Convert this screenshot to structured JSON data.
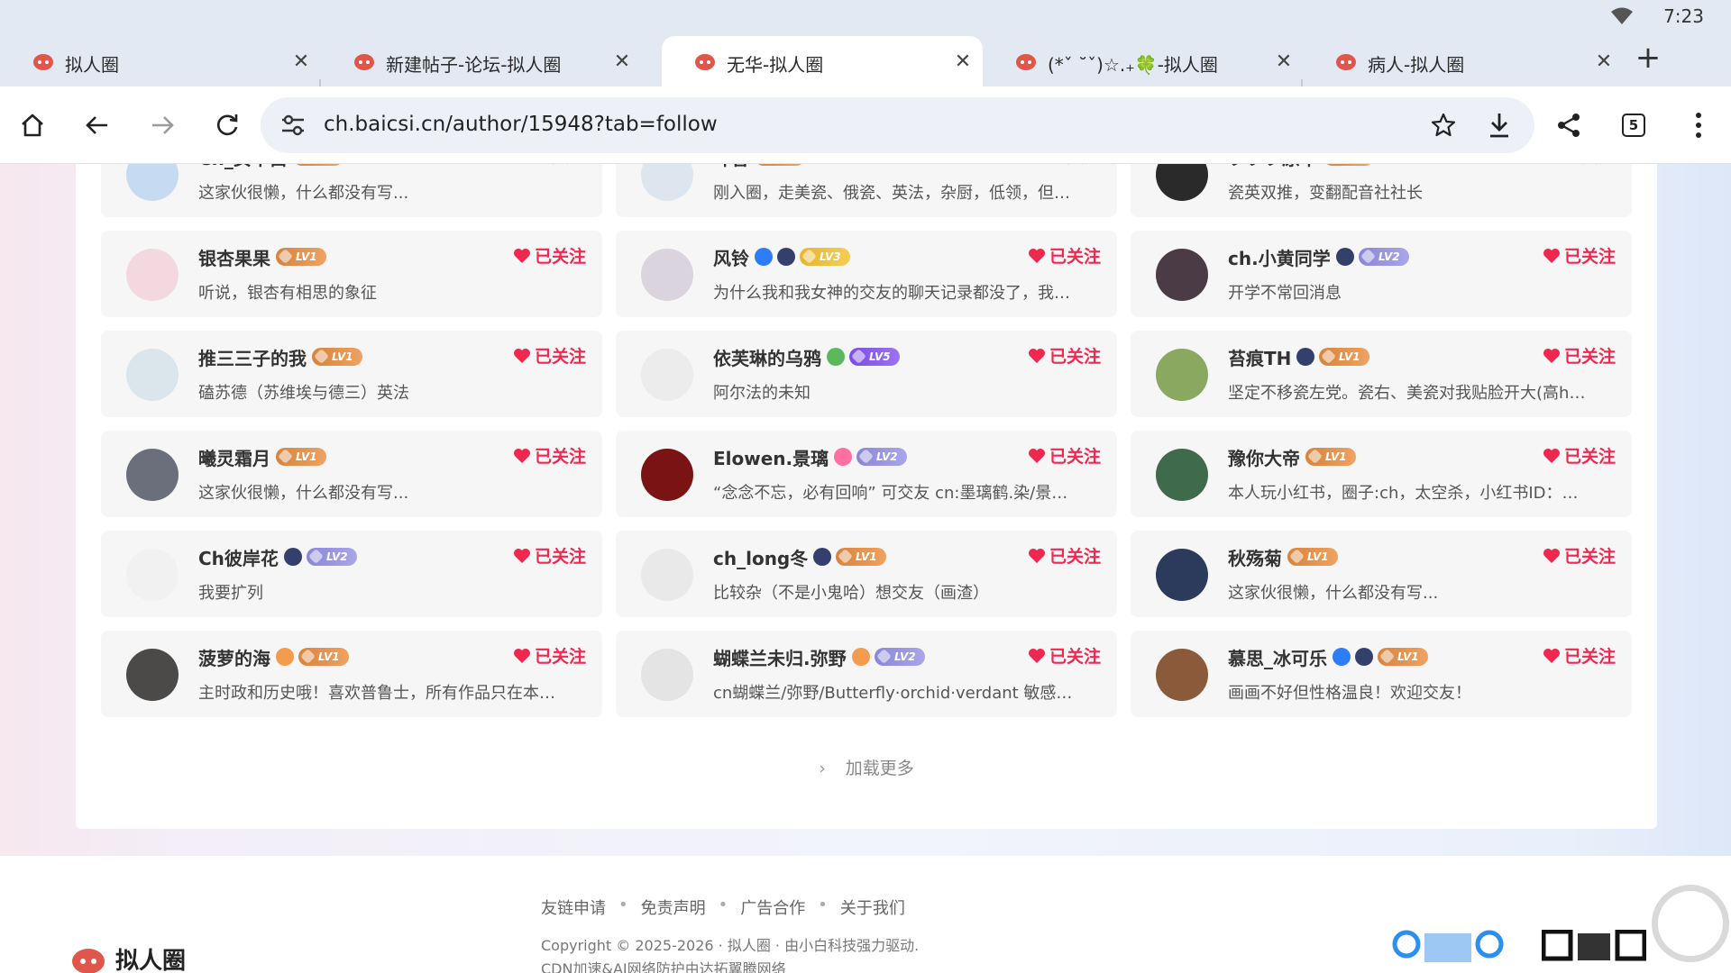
{
  "status_bar": {
    "time": "7:23"
  },
  "tabs": [
    {
      "title": "拟人圈",
      "active": false
    },
    {
      "title": "新建帖子-论坛-拟人圈",
      "active": false
    },
    {
      "title": "无华-拟人圈",
      "active": true
    },
    {
      "title": "(*ˇ ˘ˇ)☆.₊🍀-拟人圈",
      "active": false
    },
    {
      "title": "病人-拟人圈",
      "active": false
    }
  ],
  "toolbar": {
    "url": "ch.baicsi.cn/author/15948?tab=follow",
    "tab_count": "5"
  },
  "follow_label": "已关注",
  "cards": [
    {
      "name": "Ch_女干白",
      "desc": "这家伙很懒，什么都没有写...",
      "badges": [
        "lv1"
      ],
      "avatar": "#c6dbf2"
    },
    {
      "name": "叶香",
      "desc": "刚入圈，走美瓷、俄瓷、英法，杂厨，低领，但很...",
      "badges": [
        "lv1"
      ],
      "avatar": "#dde6ee"
    },
    {
      "name": "ツツツ原千",
      "desc": "瓷英双推，变翻配音社社长",
      "badges": [
        "lv1"
      ],
      "avatar": "#2a2a2a"
    },
    {
      "name": "银杏果果",
      "desc": "听说，银杏有相思的象征",
      "badges": [
        "lv1"
      ],
      "avatar": "#f3d9df"
    },
    {
      "name": "风铃",
      "desc": "为什么我和我女神的交友的聊天记录都没了，我好...",
      "badges": [
        "verified",
        "shield",
        "lv3"
      ],
      "avatar": "#d9d4dd"
    },
    {
      "name": "ch.小黄同学",
      "desc": "开学不常回消息",
      "badges": [
        "shield",
        "lv2"
      ],
      "avatar": "#4b3b45"
    },
    {
      "name": "推三三子的我",
      "desc": "磕苏德（苏维埃与德三）英法",
      "badges": [
        "lv1"
      ],
      "avatar": "#dbe6ec"
    },
    {
      "name": "依芙琳的乌鸦",
      "desc": "阿尔法的未知",
      "badges": [
        "green",
        "lv5"
      ],
      "avatar": "#ececec"
    },
    {
      "name": "苔痕TH",
      "desc": "坚定不移瓷左党。瓷右、美瓷对我贴脸开大(高h)...",
      "badges": [
        "shield",
        "lv1"
      ],
      "avatar": "#8aa860"
    },
    {
      "name": "曦灵霜月",
      "desc": "这家伙很懒，什么都没有写...",
      "badges": [
        "lv1"
      ],
      "avatar": "#6b6f7c"
    },
    {
      "name": "Elowen.景璃",
      "desc": "“念念不忘，必有回响” 可交友 cn:墨璃鹤.染/景璃 ...",
      "badges": [
        "pink",
        "lv2"
      ],
      "avatar": "#7a1414"
    },
    {
      "name": "豫你大帝",
      "desc": "本人玩小红书，圈子:ch，太空杀，小红书ID：豫...",
      "badges": [
        "lv1"
      ],
      "avatar": "#3f6a4c"
    },
    {
      "name": "Ch彼岸花",
      "desc": "我要扩列",
      "badges": [
        "shield",
        "lv2"
      ],
      "avatar": "#f1f1f1"
    },
    {
      "name": "ch_long冬",
      "desc": "比较杂（不是小鬼哈）想交友（画渣）",
      "badges": [
        "shield",
        "lv1"
      ],
      "avatar": "#e9e9e9"
    },
    {
      "name": "秋殇菊",
      "desc": "这家伙很懒，什么都没有写...",
      "badges": [
        "lv1"
      ],
      "avatar": "#2c3a5c"
    },
    {
      "name": "菠萝的海",
      "desc": "主时政和历史哦！喜欢普鲁士，所有作品只在本平...",
      "badges": [
        "orange",
        "lv1"
      ],
      "avatar": "#4c4a48"
    },
    {
      "name": "蝴蝶兰未归.弥野",
      "desc": "cn蝴蝶兰/弥野/Butterfly·orchid·verdant 敏感窝囊...",
      "badges": [
        "orange",
        "lv2"
      ],
      "avatar": "#e4e4e4"
    },
    {
      "name": "慕思_冰可乐",
      "desc": "画画不好但性格温良！欢迎交友！",
      "badges": [
        "verified",
        "shield",
        "lv1"
      ],
      "avatar": "#8a5a3a"
    }
  ],
  "load_more": "加载更多",
  "footer": {
    "links": [
      "友链申请",
      "免责声明",
      "广告合作",
      "关于我们"
    ],
    "copyright": "Copyright © 2025-2026 · 拟人圈 · 由小白科技强力驱动.",
    "cdn": "CDN加速&AI网络防护由达拓翼腾网络",
    "logo_text": "拟人圈"
  },
  "colors": {
    "accent": "#f0284f",
    "tab_strip": "#e3e9f3"
  }
}
